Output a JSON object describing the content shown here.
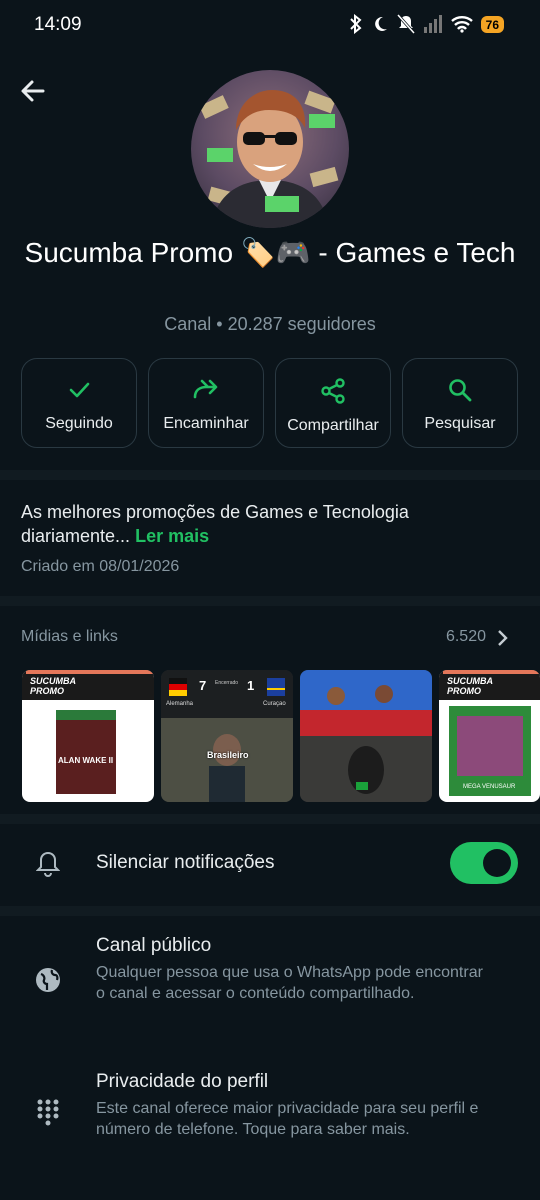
{
  "status_bar": {
    "time": "14:09",
    "battery": "76"
  },
  "channel": {
    "title": "Sucumba Promo 🏷️🎮  - Games e Tech",
    "subtitle": "Canal • 20.287 seguidores"
  },
  "actions": [
    {
      "label": "Seguindo",
      "icon": "check-icon"
    },
    {
      "label": "Encaminhar",
      "icon": "forward-icon"
    },
    {
      "label": "Compartilhar",
      "icon": "share-icon"
    },
    {
      "label": "Pesquisar",
      "icon": "search-icon"
    }
  ],
  "description": {
    "text": "As melhores promoções de Games e Tecnologia diariamente...",
    "read_more": "Ler mais",
    "created": "Criado em 08/01/2026"
  },
  "media": {
    "header": "Mídias e links",
    "count": "6.520",
    "thumbs": [
      {
        "brand": "SUCUMBA PROMO",
        "caption": "ALAN WAKE II"
      },
      {
        "team_a": "Alemanha",
        "team_b": "Curaçao",
        "score_a": "7",
        "score_b": "1",
        "status": "Encerrado",
        "tag": "Brasileiro"
      },
      {
        "caption": ""
      },
      {
        "brand": "SUCUMBA PROMO",
        "caption": "MEGA VENUSAUR"
      }
    ]
  },
  "settings": {
    "mute": {
      "label": "Silenciar notificações",
      "enabled": true
    },
    "public": {
      "label": "Canal público",
      "sub": "Qualquer pessoa que usa o WhatsApp pode encontrar o canal e acessar o conteúdo compartilhado."
    },
    "privacy": {
      "label": "Privacidade do perfil",
      "sub": "Este canal oferece maior privacidade para seu perfil e número de telefone. Toque para saber mais."
    }
  },
  "colors": {
    "background": "#0b141a",
    "accent": "#21c063",
    "muted_text": "#8696a0"
  }
}
